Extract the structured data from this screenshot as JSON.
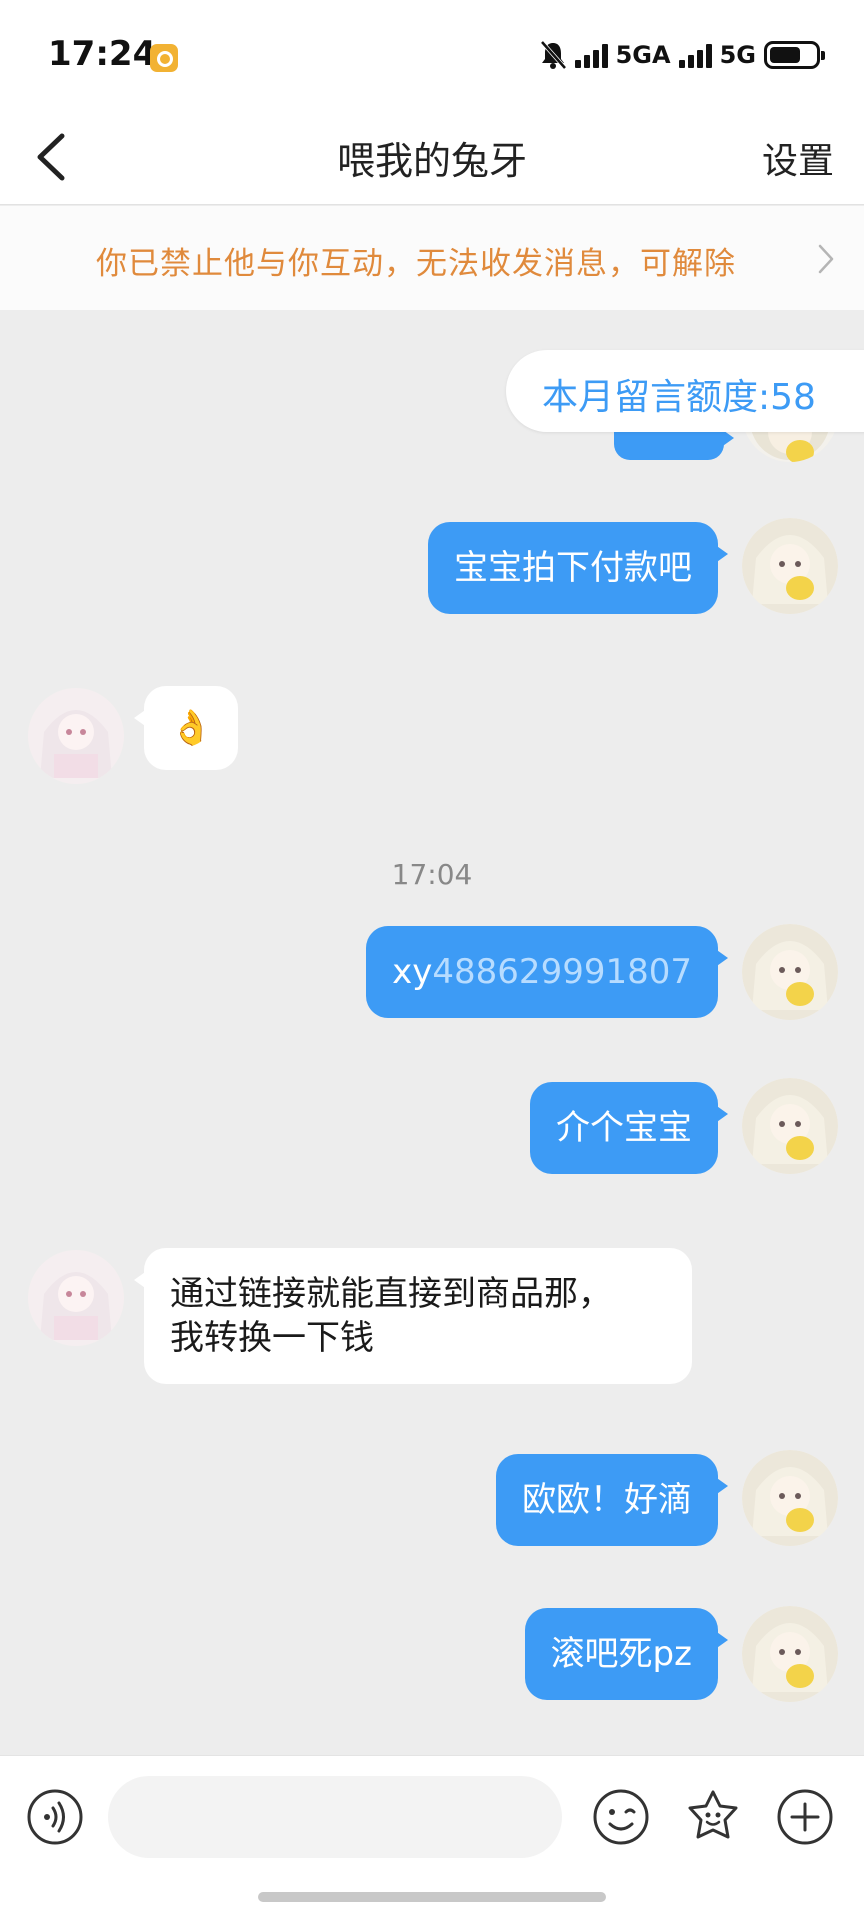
{
  "status_bar": {
    "time": "17:24",
    "network_1": "5GA",
    "network_2": "5G",
    "battery_level": 0.68,
    "icons": [
      "app-notification-icon",
      "mute-bell-icon",
      "signal-icon",
      "battery-icon"
    ]
  },
  "nav": {
    "title": "喂我的兔牙",
    "settings_label": "设置",
    "back_icon": "chevron-left-icon"
  },
  "banner": {
    "text": "你已禁止他与你互动，无法收发消息，可解除",
    "color": "#e08a3c"
  },
  "quota": {
    "text": "本月留言额度:58"
  },
  "messages": [
    {
      "sender": "me",
      "text": "宝宝拍下付款吧"
    },
    {
      "sender": "them",
      "text": "👌"
    },
    {
      "type": "timestamp",
      "text": "17:04"
    },
    {
      "sender": "me",
      "prefix": "xy",
      "link": "488629991807"
    },
    {
      "sender": "me",
      "text": "介个宝宝"
    },
    {
      "sender": "them",
      "line1": "通过链接就能直接到商品那，",
      "line2": "我转换一下钱"
    },
    {
      "sender": "me",
      "text": "欧欧！好滴"
    },
    {
      "sender": "me",
      "text": "滚吧死pz"
    }
  ],
  "input": {
    "placeholder": "",
    "icons": [
      "voice-icon",
      "emoji-icon",
      "sticker-icon",
      "plus-icon"
    ]
  },
  "colors": {
    "my_bubble": "#3d9bf5",
    "their_bubble": "#ffffff",
    "chat_background": "#ededed",
    "accent": "#3d9bf5"
  }
}
